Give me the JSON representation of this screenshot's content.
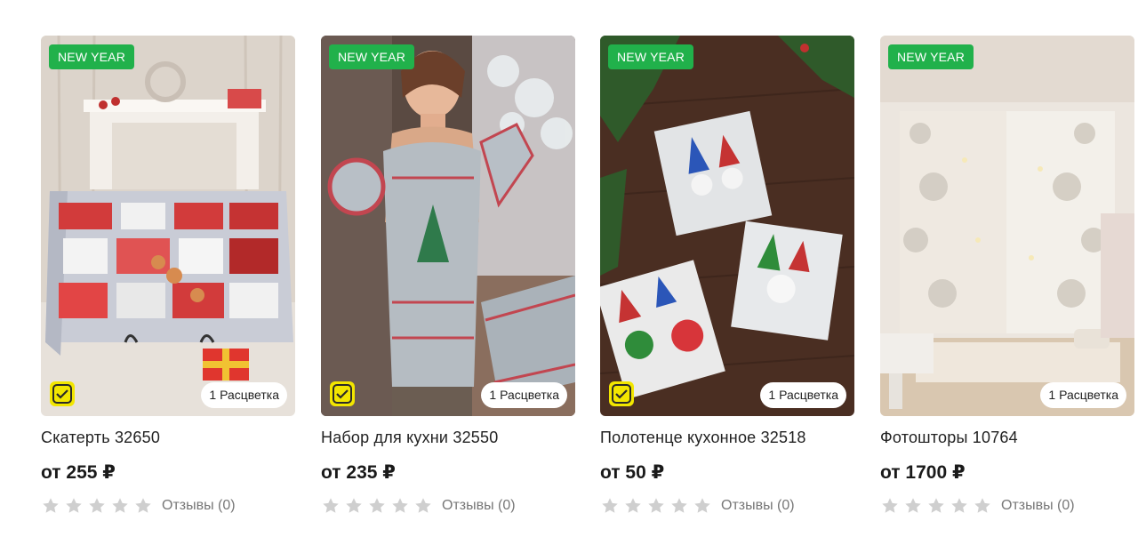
{
  "products": [
    {
      "badge": "NEW YEAR",
      "colors": "1 Расцветка",
      "title": "Скатерть 32650",
      "price": "от 255 ₽",
      "rating": 0,
      "reviews": "Отзывы (0)"
    },
    {
      "badge": "NEW YEAR",
      "colors": "1 Расцветка",
      "title": "Набор для кухни 32550",
      "price": "от 235 ₽",
      "rating": 0,
      "reviews": "Отзывы (0)"
    },
    {
      "badge": "NEW YEAR",
      "colors": "1 Расцветка",
      "title": "Полотенце кухонное 32518",
      "price": "от 50 ₽",
      "rating": 0,
      "reviews": "Отзывы (0)"
    },
    {
      "badge": "NEW YEAR",
      "colors": "1 Расцветка",
      "title": "Фотошторы 10764",
      "price": "от 1700 ₽",
      "rating": 0,
      "reviews": "Отзывы (0)"
    }
  ],
  "colors": {
    "badge": "#21b14b",
    "check_icon": "#f2e600",
    "star_empty": "#cfcfcf"
  },
  "icons": {
    "check": "double-check-square-icon",
    "star": "star-icon"
  }
}
